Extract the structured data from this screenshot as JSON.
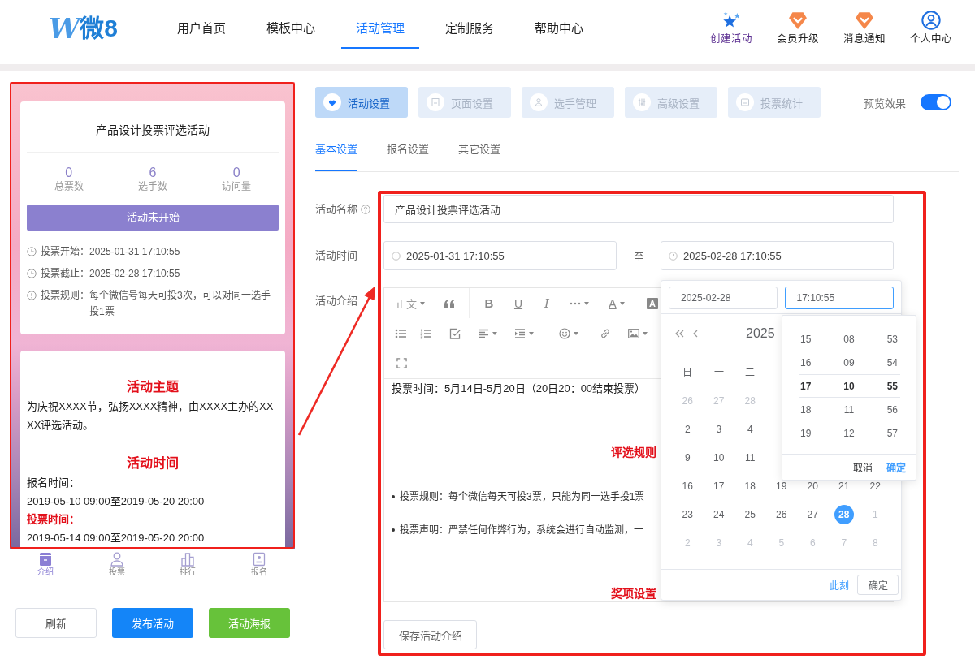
{
  "header": {
    "logo": {
      "mark": "W",
      "text": "微8"
    },
    "nav": [
      {
        "label": "用户首页",
        "selected": false
      },
      {
        "label": "模板中心",
        "selected": false
      },
      {
        "label": "活动管理",
        "selected": true
      },
      {
        "label": "定制服务",
        "selected": false
      },
      {
        "label": "帮助中心",
        "selected": false
      }
    ],
    "actions": [
      {
        "kind": "create",
        "label": "创建活动"
      },
      {
        "kind": "upgrade",
        "label": "会员升级"
      },
      {
        "kind": "notice",
        "label": "消息通知"
      },
      {
        "kind": "profile",
        "label": "个人中心"
      }
    ]
  },
  "preview": {
    "summary_card": {
      "title": "产品设计投票评选活动",
      "stats": [
        {
          "value": "0",
          "label": "总票数"
        },
        {
          "value": "6",
          "label": "选手数"
        },
        {
          "value": "0",
          "label": "访问量"
        }
      ],
      "status": "活动未开始",
      "info": [
        {
          "kind": "clock",
          "label": "投票开始：",
          "value": "2025-01-31 17:10:55"
        },
        {
          "kind": "clock",
          "label": "投票截止：",
          "value": "2025-02-28 17:10:55"
        },
        {
          "kind": "info",
          "label": "投票规则：",
          "value": "每个微信号每天可投3次，可以对同一选手投1票"
        }
      ]
    },
    "intro_card": [
      {
        "kind": "heading",
        "text": "活动主题"
      },
      {
        "kind": "paragraph",
        "text": "为庆祝XXXX节，弘扬XXXX精神，由XXXX主办的XXXX评选活动。"
      },
      {
        "kind": "heading",
        "text": "活动时间"
      },
      {
        "kind": "paragraph",
        "text": "报名时间："
      },
      {
        "kind": "paragraph",
        "text": "2019-05-10 09:00至2019-05-20 20:00"
      },
      {
        "kind": "emphasis",
        "text": "投票时间："
      },
      {
        "kind": "paragraph",
        "text": "2019-05-14 09:00至2019-05-20 20:00"
      }
    ],
    "bottom_nav": [
      {
        "kind": "intro",
        "label": "介绍",
        "selected": true
      },
      {
        "kind": "vote",
        "label": "投票",
        "selected": false
      },
      {
        "kind": "rank",
        "label": "排行",
        "selected": false
      },
      {
        "kind": "signup",
        "label": "报名",
        "selected": false
      }
    ]
  },
  "preview_buttons": [
    {
      "kind": "refresh",
      "label": "刷新"
    },
    {
      "kind": "publish",
      "label": "发布活动"
    },
    {
      "kind": "poster",
      "label": "活动海报"
    }
  ],
  "steps": [
    {
      "kind": "activity",
      "label": "活动设置",
      "selected": true
    },
    {
      "kind": "page",
      "label": "页面设置",
      "selected": false
    },
    {
      "kind": "players",
      "label": "选手管理",
      "selected": false
    },
    {
      "kind": "advanced",
      "label": "高级设置",
      "selected": false
    },
    {
      "kind": "stats",
      "label": "投票统计",
      "selected": false
    }
  ],
  "preview_toggle": {
    "label": "预览效果",
    "on": true
  },
  "subtabs": [
    {
      "label": "基本设置",
      "selected": true
    },
    {
      "label": "报名设置",
      "selected": false
    },
    {
      "label": "其它设置",
      "selected": false
    }
  ],
  "form": {
    "name": {
      "label": "活动名称",
      "value": "产品设计投票评选活动"
    },
    "time": {
      "label": "活动时间",
      "start": "2025-01-31 17:10:55",
      "separator": "至",
      "end": "2025-02-28 17:10:55"
    },
    "intro": {
      "label": "活动介绍"
    }
  },
  "editor": {
    "toolbar_rows": [
      [
        {
          "kind": "format",
          "label": "正文"
        },
        {
          "kind": "quote"
        },
        {
          "kind": "divider"
        },
        {
          "kind": "bold",
          "label": "B"
        },
        {
          "kind": "underline",
          "label": "U"
        },
        {
          "kind": "italic",
          "label": "I"
        },
        {
          "kind": "more"
        },
        {
          "kind": "color",
          "label": "A"
        },
        {
          "kind": "highlight",
          "label": "A"
        }
      ],
      [
        {
          "kind": "bullets"
        },
        {
          "kind": "numbers"
        },
        {
          "kind": "todo"
        },
        {
          "kind": "align"
        },
        {
          "kind": "indent"
        },
        {
          "kind": "divider"
        },
        {
          "kind": "emoji"
        },
        {
          "kind": "link"
        },
        {
          "kind": "image"
        }
      ],
      [
        {
          "kind": "fullscreen"
        }
      ]
    ],
    "content": [
      {
        "kind": "paragraph",
        "text": "投票时间：5月14日-5月20日（20日20：00结束投票）"
      },
      {
        "kind": "heading",
        "text": "评选规则"
      },
      {
        "kind": "bullet",
        "text": "投票规则：每个微信每天可投3票，只能为同一选手投1票"
      },
      {
        "kind": "bullet",
        "text": "投票声明：严禁任何作弊行为，系统会进行自动监测，一"
      },
      {
        "kind": "heading",
        "text": "奖项设置"
      }
    ],
    "save_button": "保存活动介绍"
  },
  "date_picker": {
    "inputs": [
      {
        "kind": "date",
        "value": "2025-02-28",
        "focused": false
      },
      {
        "kind": "time",
        "value": "17:10:55",
        "focused": true
      }
    ],
    "month_label": "2025",
    "weekdays": [
      "日",
      "一",
      "二"
    ],
    "weeks": [
      [
        {
          "day": "26",
          "muted": true,
          "selected": false
        },
        {
          "day": "27",
          "muted": true,
          "selected": false
        },
        {
          "day": "28",
          "muted": true,
          "selected": false
        }
      ],
      [
        {
          "day": "2",
          "muted": false,
          "selected": false
        },
        {
          "day": "3",
          "muted": false,
          "selected": false
        },
        {
          "day": "4",
          "muted": false,
          "selected": false
        }
      ],
      [
        {
          "day": "9",
          "muted": false,
          "selected": false
        },
        {
          "day": "10",
          "muted": false,
          "selected": false
        },
        {
          "day": "11",
          "muted": false,
          "selected": false
        }
      ],
      [
        {
          "day": "16",
          "muted": false,
          "selected": false
        },
        {
          "day": "17",
          "muted": false,
          "selected": false
        },
        {
          "day": "18",
          "muted": false,
          "selected": false
        },
        {
          "day": "19",
          "muted": false,
          "selected": false
        },
        {
          "day": "20",
          "muted": false,
          "selected": false
        },
        {
          "day": "21",
          "muted": false,
          "selected": false
        },
        {
          "day": "22",
          "muted": false,
          "selected": false
        }
      ],
      [
        {
          "day": "23",
          "muted": false,
          "selected": false
        },
        {
          "day": "24",
          "muted": false,
          "selected": false
        },
        {
          "day": "25",
          "muted": false,
          "selected": false
        },
        {
          "day": "26",
          "muted": false,
          "selected": false
        },
        {
          "day": "27",
          "muted": false,
          "selected": false
        },
        {
          "day": "28",
          "muted": false,
          "selected": true
        },
        {
          "day": "1",
          "muted": true,
          "selected": false
        }
      ],
      [
        {
          "day": "2",
          "muted": true,
          "selected": false
        },
        {
          "day": "3",
          "muted": true,
          "selected": false
        },
        {
          "day": "4",
          "muted": true,
          "selected": false
        },
        {
          "day": "5",
          "muted": true,
          "selected": false
        },
        {
          "day": "6",
          "muted": true,
          "selected": false
        },
        {
          "day": "7",
          "muted": true,
          "selected": false
        },
        {
          "day": "8",
          "muted": true,
          "selected": false
        }
      ]
    ],
    "now_button": "此刻",
    "confirm_button": "确定",
    "time_panel": {
      "rows": [
        {
          "hour": "15",
          "minute": "08",
          "second": "53",
          "selected": false
        },
        {
          "hour": "16",
          "minute": "09",
          "second": "54",
          "selected": false
        },
        {
          "hour": "17",
          "minute": "10",
          "second": "55",
          "selected": true
        },
        {
          "hour": "18",
          "minute": "11",
          "second": "56",
          "selected": false
        },
        {
          "hour": "19",
          "minute": "12",
          "second": "57",
          "selected": false
        }
      ],
      "cancel": "取消",
      "confirm": "确定"
    }
  }
}
